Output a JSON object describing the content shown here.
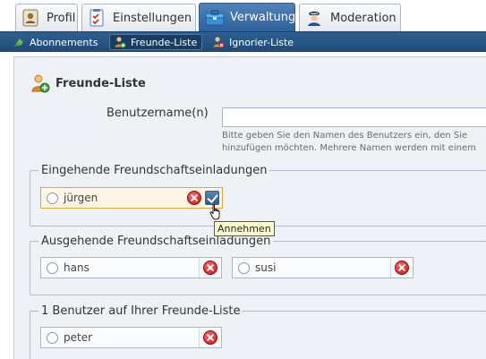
{
  "tabs": [
    {
      "label": "Profil",
      "icon": "profile-card-icon"
    },
    {
      "label": "Einstellungen",
      "icon": "checklist-icon"
    },
    {
      "label": "Verwaltung",
      "icon": "toolbox-icon"
    },
    {
      "label": "Moderation",
      "icon": "police-officer-icon"
    }
  ],
  "subtabs": [
    {
      "label": "Abonnements",
      "icon": "rss-feed-icon"
    },
    {
      "label": "Freunde-Liste",
      "icon": "friend-add-icon"
    },
    {
      "label": "Ignorier-Liste",
      "icon": "user-block-icon"
    }
  ],
  "page": {
    "heading": "Freunde-Liste",
    "username_label": "Benutzername(n)",
    "username_value": "",
    "hint": "Bitte geben Sie den Namen des Benutzers ein, den Sie hinzufügen möchten. Mehrere Namen werden mit einem Komma voneinander getrennt."
  },
  "incoming": {
    "legend": "Eingehende Freundschaftseinladungen",
    "items": [
      {
        "name": "jürgen"
      }
    ],
    "accept_tooltip": "Annehmen"
  },
  "outgoing": {
    "legend": "Ausgehende Freundschaftseinladungen",
    "items": [
      {
        "name": "hans"
      },
      {
        "name": "susi"
      }
    ]
  },
  "friends": {
    "legend": "1 Benutzer auf Ihrer Freunde-Liste",
    "items": [
      {
        "name": "peter"
      }
    ]
  },
  "colors": {
    "accent": "#2f6199",
    "highlight": "#e3a43a",
    "background": "#eef2f6"
  }
}
